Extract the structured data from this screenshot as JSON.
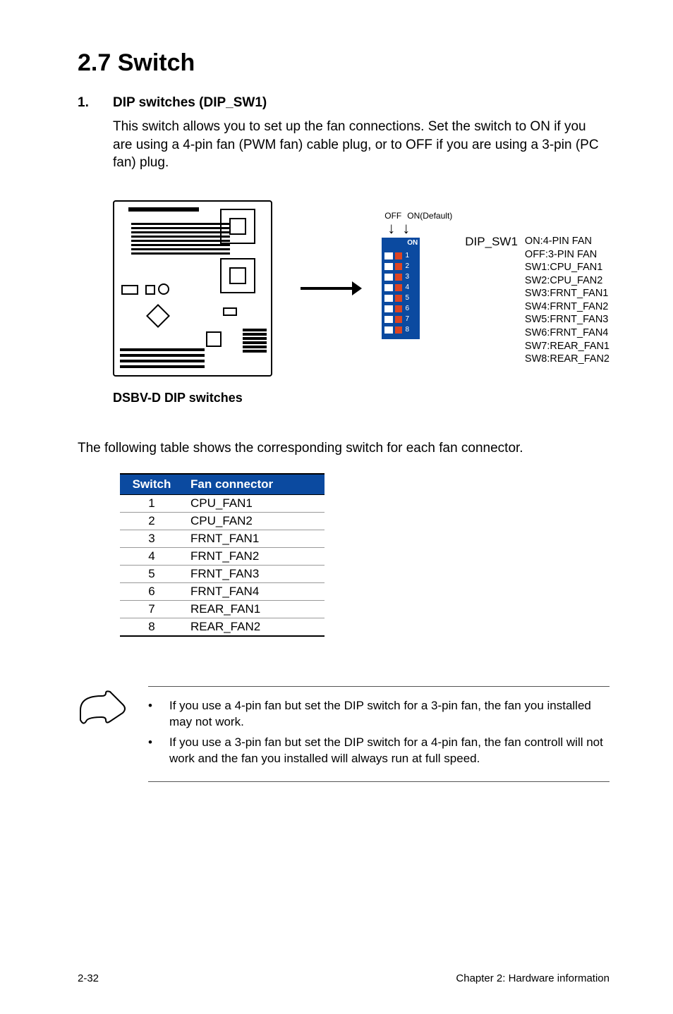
{
  "section": {
    "title": "2.7    Switch"
  },
  "item": {
    "num": "1.",
    "title": "DIP switches (DIP_SW1)",
    "body": "This switch allows you to set up the fan connections. Set the switch to ON if you are using a 4-pin fan (PWM fan) cable plug, or to OFF if you are using a 3-pin (PC fan) plug."
  },
  "diagram": {
    "off_label": "OFF",
    "on_label": "ON(Default)",
    "dip_on_text": "ON",
    "dip_numbers": [
      "1",
      "2",
      "3",
      "4",
      "5",
      "6",
      "7",
      "8"
    ],
    "connector_name": "DIP_SW1",
    "fan_key": [
      "ON:4-PIN FAN",
      "OFF:3-PIN FAN",
      "SW1:CPU_FAN1",
      "SW2:CPU_FAN2",
      "SW3:FRNT_FAN1",
      "SW4:FRNT_FAN2",
      "SW5:FRNT_FAN3",
      "SW6:FRNT_FAN4",
      "SW7:REAR_FAN1",
      "SW8:REAR_FAN2"
    ],
    "caption": "DSBV-D DIP switches"
  },
  "mid_note": "The following table shows the corresponding switch for each fan connector.",
  "table": {
    "headers": {
      "switch": "Switch",
      "fan": "Fan connector"
    },
    "rows": [
      {
        "sw": "1",
        "fan": "CPU_FAN1"
      },
      {
        "sw": "2",
        "fan": "CPU_FAN2"
      },
      {
        "sw": "3",
        "fan": "FRNT_FAN1"
      },
      {
        "sw": "4",
        "fan": "FRNT_FAN2"
      },
      {
        "sw": "5",
        "fan": "FRNT_FAN3"
      },
      {
        "sw": "6",
        "fan": "FRNT_FAN4"
      },
      {
        "sw": "7",
        "fan": "REAR_FAN1"
      },
      {
        "sw": "8",
        "fan": "REAR_FAN2"
      }
    ]
  },
  "notes": {
    "bullet": "•",
    "items": [
      "If you use a 4-pin fan but set the DIP switch for a 3-pin fan, the fan you installed may not work.",
      "If you use a 3-pin fan but set the DIP switch for a 4-pin fan, the fan controll will not work and the fan you installed will always run at full speed."
    ]
  },
  "footer": {
    "left": "2-32",
    "right": "Chapter 2: Hardware information"
  }
}
